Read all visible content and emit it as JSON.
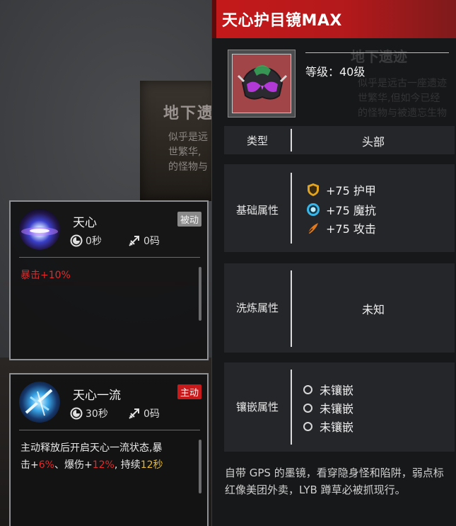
{
  "background": {
    "card_title": "地下遗",
    "card_desc": "似乎是远\n世繁华,\n的怪物与",
    "ghost_title": "地下遗迹",
    "ghost_desc": "似乎是远古一座遗迹\n世繁华,但如今已经\n的怪物与被遗忘生物"
  },
  "skills": [
    {
      "name": "天心",
      "tag": "被动",
      "cooldown": "0秒",
      "cost": "0码",
      "desc_prefix": "暴击+10%"
    },
    {
      "name": "天心一流",
      "tag": "主动",
      "cooldown": "30秒",
      "cost": "0码",
      "desc_line1": "主动释放后开启天心一流状态,暴",
      "desc_a": "击+",
      "desc_crit": "6%",
      "desc_b": "、爆伤+",
      "desc_dmg": "12%",
      "desc_c": ", 持续",
      "desc_dur": "12秒"
    }
  ],
  "item": {
    "title": "天心护目镜MAX",
    "level": "等级：40级",
    "type_label": "类型",
    "type_value": "头部",
    "base_label": "基础属性",
    "base_attrs": [
      {
        "icon": "shield-icon",
        "text": "+75 护甲",
        "color": "#e3a51f"
      },
      {
        "icon": "magic-resist-icon",
        "text": "+75 魔抗",
        "color": "#38b6e8"
      },
      {
        "icon": "attack-icon",
        "text": "+75 攻击",
        "color": "#e07a22"
      }
    ],
    "refine_label": "洗炼属性",
    "refine_value": "未知",
    "socket_label": "镶嵌属性",
    "sockets": [
      "未镶嵌",
      "未镶嵌",
      "未镶嵌"
    ],
    "flavor": "自带 GPS 的墨镜，看穿隐身怪和陷阱，弱点标红像美团外卖，LYB 蹲草必被抓现行。"
  },
  "colors": {
    "header_red": "#c5191b",
    "active_tag": "#c8191b",
    "crit_red": "#e12a2a",
    "duration_gold": "#e6b730"
  }
}
